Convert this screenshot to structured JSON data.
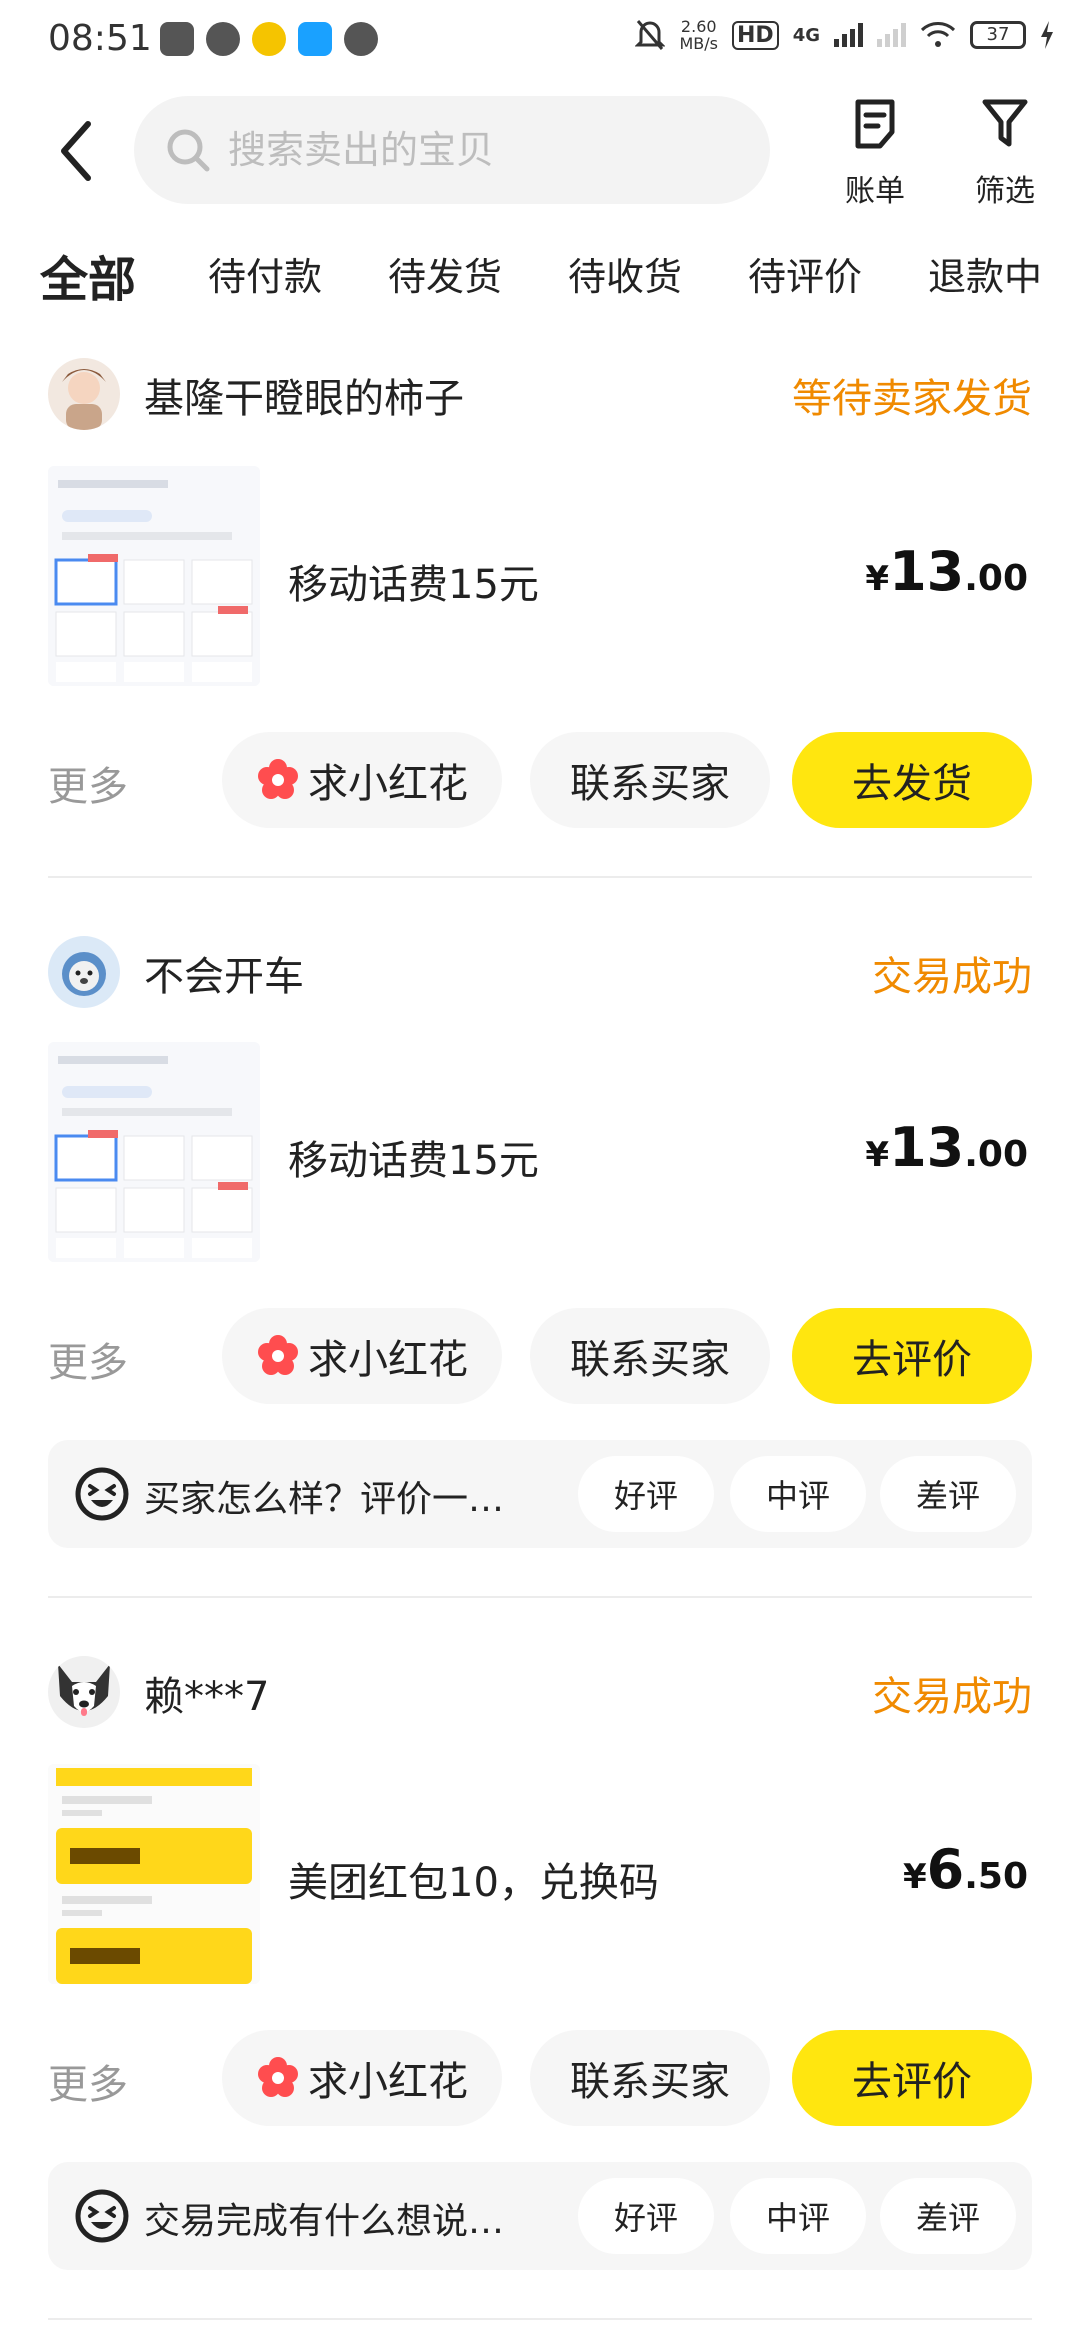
{
  "status_bar": {
    "time": "08:51",
    "speed_value": "2.60",
    "speed_unit": "MB/s",
    "hd": "HD",
    "network": "4G",
    "battery": "37"
  },
  "header": {
    "search_placeholder": "搜索卖出的宝贝",
    "bill_label": "账单",
    "filter_label": "筛选"
  },
  "tabs": [
    "全部",
    "待付款",
    "待发货",
    "待收货",
    "待评价",
    "退款中"
  ],
  "orders": [
    {
      "seller": "基隆干瞪眼的柿子",
      "status": "等待卖家发货",
      "title": "移动话费15元",
      "price_currency": "¥",
      "price_int": "13",
      "price_dec": ".00",
      "more": "更多",
      "flower_label": "求小红花",
      "contact_label": "联系买家",
      "primary_label": "去发货"
    },
    {
      "seller": "不会开车",
      "status": "交易成功",
      "title": "移动话费15元",
      "price_currency": "¥",
      "price_int": "13",
      "price_dec": ".00",
      "more": "更多",
      "flower_label": "求小红花",
      "contact_label": "联系买家",
      "primary_label": "去评价",
      "review_prompt": "买家怎么样？评价一…",
      "review_good": "好评",
      "review_mid": "中评",
      "review_bad": "差评"
    },
    {
      "seller": "赖***7",
      "status": "交易成功",
      "title": "美团红包10，兑换码",
      "price_currency": "¥",
      "price_int": "6",
      "price_dec": ".50",
      "more": "更多",
      "flower_label": "求小红花",
      "contact_label": "联系买家",
      "primary_label": "去评价",
      "review_prompt": "交易完成有什么想说…",
      "review_good": "好评",
      "review_mid": "中评",
      "review_bad": "差评"
    }
  ],
  "colors": {
    "accent_yellow": "#ffe60f",
    "status_orange": "#f08a00",
    "flower_red": "#ff4d4f"
  }
}
